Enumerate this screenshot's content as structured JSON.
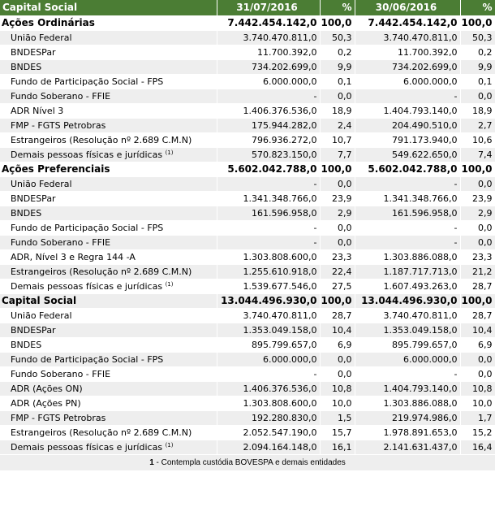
{
  "headers": [
    "Capital Social",
    "31/07/2016",
    "%",
    "30/06/2016",
    "%"
  ],
  "groups": [
    {
      "title": "Ações Ordinárias",
      "v1": "7.442.454.142,0",
      "p1": "100,0",
      "v2": "7.442.454.142,0",
      "p2": "100,0",
      "rows": [
        {
          "label": "União Federal",
          "note": "",
          "v1": "3.740.470.811,0",
          "p1": "50,3",
          "v2": "3.740.470.811,0",
          "p2": "50,3"
        },
        {
          "label": "BNDESPar",
          "note": "",
          "v1": "11.700.392,0",
          "p1": "0,2",
          "v2": "11.700.392,0",
          "p2": "0,2"
        },
        {
          "label": "BNDES",
          "note": "",
          "v1": "734.202.699,0",
          "p1": "9,9",
          "v2": "734.202.699,0",
          "p2": "9,9"
        },
        {
          "label": "Fundo de Participação Social - FPS",
          "note": "",
          "v1": "6.000.000,0",
          "p1": "0,1",
          "v2": "6.000.000,0",
          "p2": "0,1"
        },
        {
          "label": "Fundo Soberano - FFIE",
          "note": "",
          "v1": "-",
          "p1": "0,0",
          "v2": "-",
          "p2": "0,0"
        },
        {
          "label": "ADR Nível 3",
          "note": "",
          "v1": "1.406.376.536,0",
          "p1": "18,9",
          "v2": "1.404.793.140,0",
          "p2": "18,9"
        },
        {
          "label": "FMP - FGTS Petrobras",
          "note": "",
          "v1": "175.944.282,0",
          "p1": "2,4",
          "v2": "204.490.510,0",
          "p2": "2,7"
        },
        {
          "label": "Estrangeiros (Resolução nº 2.689 C.M.N)",
          "note": "",
          "v1": "796.936.272,0",
          "p1": "10,7",
          "v2": "791.173.940,0",
          "p2": "10,6"
        },
        {
          "label": "Demais pessoas físicas e jurídicas",
          "note": "(1)",
          "v1": "570.823.150,0",
          "p1": "7,7",
          "v2": "549.622.650,0",
          "p2": "7,4"
        }
      ]
    },
    {
      "title": "Ações Preferenciais",
      "v1": "5.602.042.788,0",
      "p1": "100,0",
      "v2": "5.602.042.788,0",
      "p2": "100,0",
      "rows": [
        {
          "label": "União Federal",
          "note": "",
          "v1": "-",
          "p1": "0,0",
          "v2": "-",
          "p2": "0,0"
        },
        {
          "label": "BNDESPar",
          "note": "",
          "v1": "1.341.348.766,0",
          "p1": "23,9",
          "v2": "1.341.348.766,0",
          "p2": "23,9"
        },
        {
          "label": "BNDES",
          "note": "",
          "v1": "161.596.958,0",
          "p1": "2,9",
          "v2": "161.596.958,0",
          "p2": "2,9"
        },
        {
          "label": "Fundo de Participação Social - FPS",
          "note": "",
          "v1": "-",
          "p1": "0,0",
          "v2": "-",
          "p2": "0,0"
        },
        {
          "label": "Fundo Soberano - FFIE",
          "note": "",
          "v1": "-",
          "p1": "0,0",
          "v2": "-",
          "p2": "0,0"
        },
        {
          "label": "ADR, Nível 3 e Regra 144 -A",
          "note": "",
          "v1": "1.303.808.600,0",
          "p1": "23,3",
          "v2": "1.303.886.088,0",
          "p2": "23,3"
        },
        {
          "label": "Estrangeiros (Resolução nº 2.689 C.M.N)",
          "note": "",
          "v1": "1.255.610.918,0",
          "p1": "22,4",
          "v2": "1.187.717.713,0",
          "p2": "21,2"
        },
        {
          "label": "Demais pessoas físicas e jurídicas",
          "note": "(1)",
          "v1": "1.539.677.546,0",
          "p1": "27,5",
          "v2": "1.607.493.263,0",
          "p2": "28,7"
        }
      ]
    },
    {
      "title": "Capital Social",
      "v1": "13.044.496.930,0",
      "p1": "100,0",
      "v2": "13.044.496.930,0",
      "p2": "100,0",
      "rows": [
        {
          "label": "União Federal",
          "note": "",
          "v1": "3.740.470.811,0",
          "p1": "28,7",
          "v2": "3.740.470.811,0",
          "p2": "28,7"
        },
        {
          "label": "BNDESPar",
          "note": "",
          "v1": "1.353.049.158,0",
          "p1": "10,4",
          "v2": "1.353.049.158,0",
          "p2": "10,4"
        },
        {
          "label": "BNDES",
          "note": "",
          "v1": "895.799.657,0",
          "p1": "6,9",
          "v2": "895.799.657,0",
          "p2": "6,9"
        },
        {
          "label": "Fundo de Participação Social - FPS",
          "note": "",
          "v1": "6.000.000,0",
          "p1": "0,0",
          "v2": "6.000.000,0",
          "p2": "0,0"
        },
        {
          "label": "Fundo Soberano - FFIE",
          "note": "",
          "v1": "-",
          "p1": "0,0",
          "v2": "-",
          "p2": "0,0"
        },
        {
          "label": "ADR (Ações ON)",
          "note": "",
          "v1": "1.406.376.536,0",
          "p1": "10,8",
          "v2": "1.404.793.140,0",
          "p2": "10,8"
        },
        {
          "label": "ADR (Ações PN)",
          "note": "",
          "v1": "1.303.808.600,0",
          "p1": "10,0",
          "v2": "1.303.886.088,0",
          "p2": "10,0"
        },
        {
          "label": "FMP - FGTS Petrobras",
          "note": "",
          "v1": "192.280.830,0",
          "p1": "1,5",
          "v2": "219.974.986,0",
          "p2": "1,7"
        },
        {
          "label": "Estrangeiros (Resolução nº 2.689 C.M.N)",
          "note": "",
          "v1": "2.052.547.190,0",
          "p1": "15,7",
          "v2": "1.978.891.653,0",
          "p2": "15,2"
        },
        {
          "label": "Demais pessoas físicas e jurídicas",
          "note": "(1)",
          "v1": "2.094.164.148,0",
          "p1": "16,1",
          "v2": "2.141.631.437,0",
          "p2": "16,4"
        }
      ]
    }
  ],
  "footnote": {
    "mark": "1",
    "text": " - Contempla custódia BOVESPA e demais entidades"
  }
}
